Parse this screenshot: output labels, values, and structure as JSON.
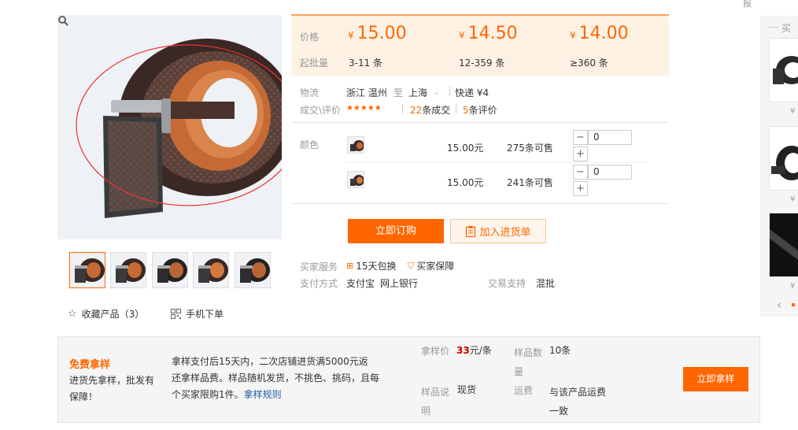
{
  "top_right_fragment": "报",
  "price_box": {
    "price_label": "价格",
    "moq_label": "起批量",
    "currency": "¥",
    "tiers": [
      {
        "price": "15.00",
        "moq": "3-11 条"
      },
      {
        "price": "14.50",
        "moq": "12-359 条"
      },
      {
        "price": "14.00",
        "moq": "≥360 条"
      }
    ]
  },
  "logistics": {
    "label": "物流",
    "from": "浙江 温州",
    "to_word": "至",
    "to": "上海",
    "shipping": "快递 ¥4"
  },
  "transactions": {
    "label": "成交\\评价",
    "stars": "★★★★★",
    "deals_count": "22",
    "deals_suffix": "条成交",
    "reviews_count": "5",
    "reviews_suffix": "条评价"
  },
  "color_label": "颜色",
  "skus": [
    {
      "price": "15.00元",
      "stock": "275条可售",
      "qty": "0"
    },
    {
      "price": "15.00元",
      "stock": "241条可售",
      "qty": "0"
    }
  ],
  "qty_minus": "−",
  "qty_plus": "+",
  "buttons": {
    "buy_now": "立即订购",
    "add_to_list": "加入进货单",
    "sample_now": "立即拿样"
  },
  "services": {
    "label": "买家服务",
    "items": [
      "15天包换",
      "买家保障"
    ]
  },
  "payment": {
    "label": "支付方式",
    "items": [
      "支付宝",
      "网上银行"
    ]
  },
  "trade_support": {
    "label": "交易支持",
    "value": "混批"
  },
  "favorite": {
    "label": "收藏产品（3）"
  },
  "mobile_order": {
    "label": "手机下单"
  },
  "sample": {
    "title": "免费拿样",
    "subtitle": "进货先拿样，批发有保障！",
    "desc_lines": [
      "拿样支付后15天内，二次店铺进货满5000元返",
      "还拿样品费。样品随机发货，不挑色、挑码，且每",
      "个买家限购1件。"
    ],
    "rules_link": "拿样规则",
    "price_label": "拿样价",
    "price_value": "33",
    "price_unit": "元/条",
    "qty_label_1": "样品数",
    "qty_label_2": "量",
    "qty_value": "10条",
    "desc_label_1": "样品说",
    "desc_label_2": "明",
    "desc_value": "现货",
    "freight_label": "运费",
    "freight_value_1": "与该产品运费",
    "freight_value_2": "一致"
  },
  "rail": {
    "title": "买家",
    "prices": [
      "¥",
      "¥",
      "¥"
    ],
    "prev_arrow": "‹"
  },
  "colors": {
    "accent": "#ff6600",
    "price_bg": "#fdf1e4",
    "sample_bg": "#f5f5f5"
  }
}
